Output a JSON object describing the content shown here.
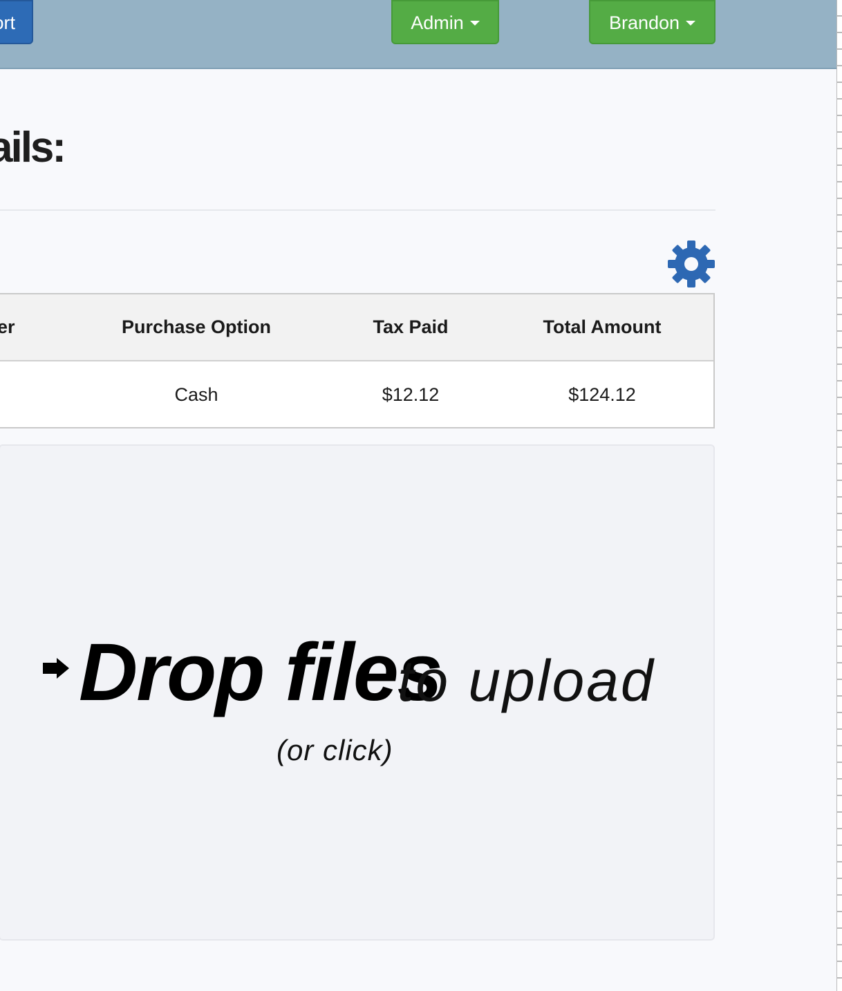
{
  "navbar": {
    "left_button_label": "ort",
    "admin_button_label": "Admin",
    "user_button_label": "Brandon"
  },
  "page": {
    "heading": "ails:"
  },
  "table": {
    "columns": [
      "er",
      "Purchase Option",
      "Tax Paid",
      "Total Amount"
    ],
    "rows": [
      {
        "purchase_option": "Cash",
        "tax_paid": "$12.12",
        "total_amount": "$124.12"
      }
    ]
  },
  "dropzone": {
    "bold_text": "Drop files",
    "light_text": "to upload",
    "sub_text": "(or click)"
  },
  "icons": {
    "settings": "gear-icon",
    "arrow": "arrow-right-icon"
  },
  "colors": {
    "navbar": "#95b2c5",
    "primary_button": "#2d6bb6",
    "success_button": "#54ac45",
    "gear": "#2d68b3"
  }
}
